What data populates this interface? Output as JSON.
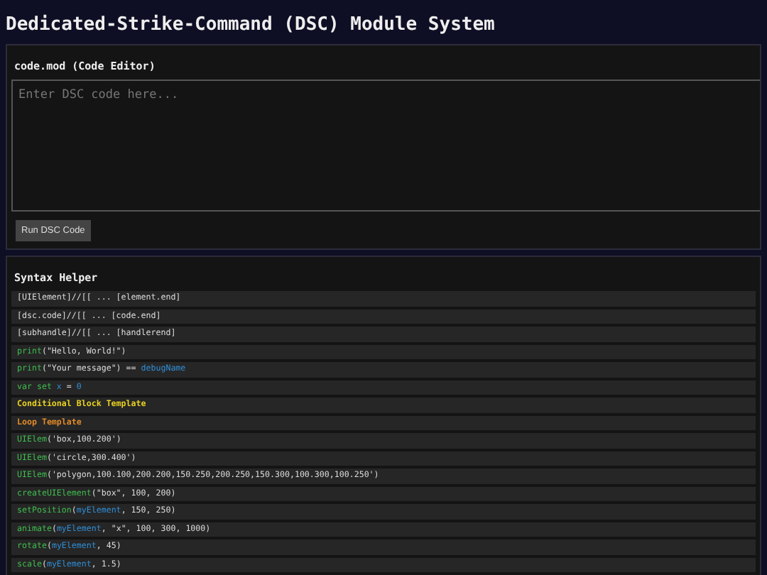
{
  "title": "Dedicated-Strike-Command (DSC) Module System",
  "editor": {
    "heading": "code.mod (Code Editor)",
    "placeholder": "Enter DSC code here...",
    "button": "Run DSC Code"
  },
  "helper": {
    "heading": "Syntax Helper",
    "rows": [
      {
        "parts": [
          {
            "text": "[UIElement]//[[ ... [element.end]",
            "kind": "plain"
          }
        ]
      },
      {
        "parts": [
          {
            "text": "[dsc.code]//[[ ... [code.end]",
            "kind": "plain"
          }
        ]
      },
      {
        "parts": [
          {
            "text": "[subhandle]//[[ ... [handlerend]",
            "kind": "plain"
          }
        ]
      },
      {
        "parts": [
          {
            "text": "print",
            "kind": "func"
          },
          {
            "text": "(\"Hello, World!\")",
            "kind": "plain"
          }
        ]
      },
      {
        "parts": [
          {
            "text": "print",
            "kind": "func"
          },
          {
            "text": "(\"Your message\") ==",
            "kind": "plain"
          },
          {
            "text": " debugName",
            "kind": "var"
          }
        ]
      },
      {
        "parts": [
          {
            "text": "var set",
            "kind": "func"
          },
          {
            "text": " x",
            "kind": "var"
          },
          {
            "text": " = ",
            "kind": "plain"
          },
          {
            "text": "0",
            "kind": "var"
          }
        ]
      },
      {
        "parts": [
          {
            "text": "Conditional Block Template",
            "kind": "cond"
          }
        ]
      },
      {
        "parts": [
          {
            "text": "Loop Template",
            "kind": "loop"
          }
        ]
      },
      {
        "parts": [
          {
            "text": "UIElem",
            "kind": "func"
          },
          {
            "text": "('box,100.200')",
            "kind": "plain"
          }
        ]
      },
      {
        "parts": [
          {
            "text": "UIElem",
            "kind": "func"
          },
          {
            "text": "('circle,300.400')",
            "kind": "plain"
          }
        ]
      },
      {
        "parts": [
          {
            "text": "UIElem",
            "kind": "func"
          },
          {
            "text": "('polygon,100.100,200.200,150.250,200.250,150.300,100.300,100.250')",
            "kind": "plain"
          }
        ]
      },
      {
        "parts": [
          {
            "text": "createUIElement",
            "kind": "func"
          },
          {
            "text": "(\"box\", 100, 200)",
            "kind": "plain"
          }
        ]
      },
      {
        "parts": [
          {
            "text": "setPosition",
            "kind": "func"
          },
          {
            "text": "(",
            "kind": "plain"
          },
          {
            "text": "myElement",
            "kind": "var"
          },
          {
            "text": ", 150, 250)",
            "kind": "plain"
          }
        ]
      },
      {
        "parts": [
          {
            "text": "animate",
            "kind": "func"
          },
          {
            "text": "(",
            "kind": "plain"
          },
          {
            "text": "myElement",
            "kind": "var"
          },
          {
            "text": ", \"x\", 100, 300, 1000)",
            "kind": "plain"
          }
        ]
      },
      {
        "parts": [
          {
            "text": "rotate",
            "kind": "func"
          },
          {
            "text": "(",
            "kind": "plain"
          },
          {
            "text": "myElement",
            "kind": "var"
          },
          {
            "text": ", 45)",
            "kind": "plain"
          }
        ]
      },
      {
        "parts": [
          {
            "text": "scale",
            "kind": "func"
          },
          {
            "text": "(",
            "kind": "plain"
          },
          {
            "text": "myElement",
            "kind": "var"
          },
          {
            "text": ", 1.5)",
            "kind": "plain"
          }
        ]
      }
    ]
  }
}
